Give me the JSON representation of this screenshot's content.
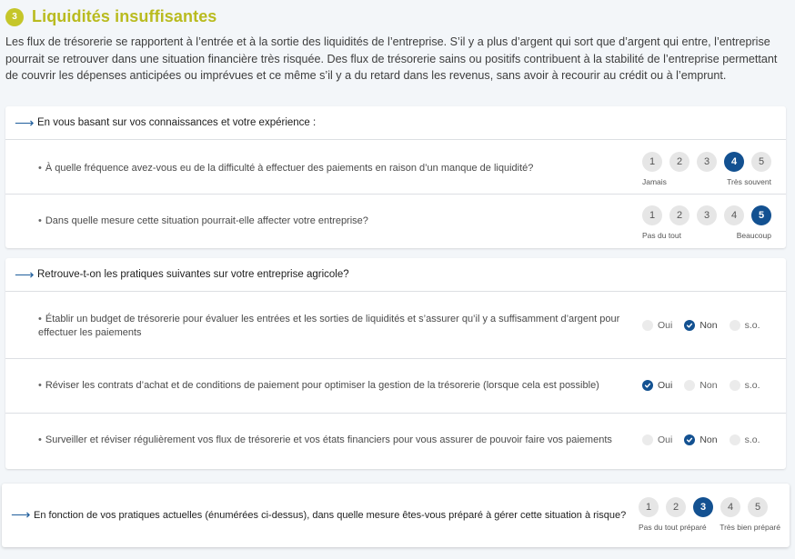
{
  "section": {
    "step_number": "3",
    "title": "Liquidités insuffisantes",
    "intro": "Les flux de trésorerie se rapportent à l’entrée et à la sortie des liquidités de l’entreprise. S’il y a plus d’argent qui sort que d’argent qui entre, l’entreprise pourrait se retrouver dans une situation financière très risquée. Des flux de trésorerie sains ou positifs contribuent à la stabilité de l’entreprise permettant de couvrir les dépenses anticipées ou imprévues et ce même s’il y a du retard dans les revenus, sans avoir à recourir au crédit ou à l’emprunt."
  },
  "experience_card": {
    "heading": "En vous basant sur vos connaissances et votre expérience :",
    "questions": [
      {
        "text": "À quelle fréquence avez-vous eu de la difficulté à effectuer des paiements en raison d’un manque de liquidité?",
        "options": [
          "1",
          "2",
          "3",
          "4",
          "5"
        ],
        "selected": "4",
        "min_label": "Jamais",
        "max_label": "Très souvent"
      },
      {
        "text": "Dans quelle mesure cette situation pourrait-elle affecter votre entreprise?",
        "options": [
          "1",
          "2",
          "3",
          "4",
          "5"
        ],
        "selected": "5",
        "min_label": "Pas du tout",
        "max_label": "Beaucoup"
      }
    ]
  },
  "practices_card": {
    "heading": "Retrouve-t-on les pratiques suivantes sur votre entreprise agricole?",
    "choice_labels": [
      "Oui",
      "Non",
      "s.o."
    ],
    "practices": [
      {
        "text": "Établir un budget de trésorerie pour évaluer les entrées et les sorties de liquidités et s’assurer qu’il y a suffisamment d’argent pour effectuer les paiements",
        "selected": "Non"
      },
      {
        "text": "Réviser les contrats d’achat et de conditions de paiement pour optimiser la gestion de la trésorerie (lorsque cela est possible)",
        "selected": "Oui"
      },
      {
        "text": "Surveiller et réviser régulièrement vos flux de trésorerie et vos états financiers pour vous assurer de pouvoir faire vos paiements",
        "selected": "Non"
      }
    ]
  },
  "preparedness_card": {
    "text": "En fonction de vos pratiques actuelles (énumérées ci-dessus), dans quelle mesure êtes-vous préparé à gérer cette situation à risque?",
    "options": [
      "1",
      "2",
      "3",
      "4",
      "5"
    ],
    "selected": "3",
    "min_label": "Pas du tout préparé",
    "max_label": "Très bien préparé"
  },
  "colors": {
    "accent_title": "#b9bb1f",
    "selected_blue": "#135191"
  }
}
